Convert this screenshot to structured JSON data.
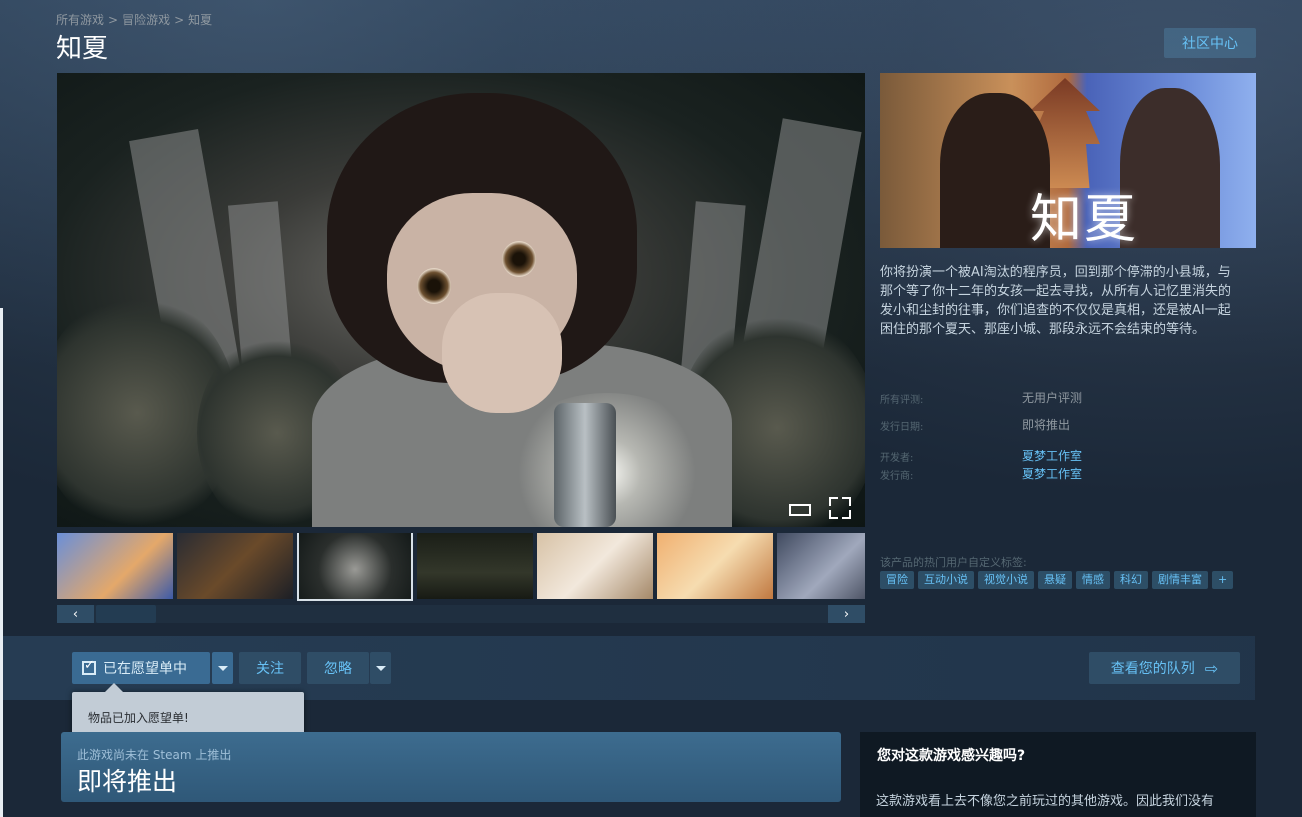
{
  "breadcrumb": {
    "root": "所有游戏",
    "category": "冒险游戏",
    "current": "知夏",
    "separator": ">"
  },
  "title": "知夏",
  "community_hub": "社区中心",
  "capsule_logo": "知夏",
  "description": "你将扮演一个被AI淘汰的程序员，回到那个停滞的小县城，与那个等了你十二年的女孩一起去寻找，从所有人记忆里消失的发小和尘封的往事，你们追查的不仅仅是真相，还是被AI一起困住的那个夏天、那座小城、那段永远不会结束的等待。",
  "meta": {
    "reviews_label": "所有评测:",
    "reviews_value": "无用户评测",
    "release_label": "发行日期:",
    "release_value": "即将推出",
    "developer_label": "开发者:",
    "developer_value": "夏梦工作室",
    "publisher_label": "发行商:",
    "publisher_value": "夏梦工作室"
  },
  "tags_label": "该产品的热门用户自定义标签:",
  "tags": [
    "冒险",
    "互动小说",
    "视觉小说",
    "悬疑",
    "情感",
    "科幻",
    "剧情丰富",
    "+"
  ],
  "media": {
    "selected_thumb_index": 2,
    "thumb_count": 7
  },
  "scroll": {
    "left": "‹",
    "right": "›"
  },
  "actions": {
    "wishlist": "已在愿望单中",
    "follow": "关注",
    "ignore": "忽略",
    "queue": "查看您的队列",
    "queue_arrow": "⇨"
  },
  "tooltip": "物品已加入愿望单!",
  "notice": {
    "small": "此游戏尚未在 Steam 上推出",
    "big": "即将推出"
  },
  "interest": {
    "title": "您对这款游戏感兴趣吗?",
    "text": "这款游戏看上去不像您之前玩过的其他游戏。因此我们没有"
  },
  "colors": {
    "accent": "#67c1f5",
    "link": "#66c0f4",
    "background": "#1b2838",
    "button": "#2f4d66",
    "wishlist_active": "#3a6b93"
  },
  "icons": {
    "fullscreen": "fullscreen-icon",
    "widescreen": "widescreen-icon",
    "checkbox": "checkbox-checked-icon",
    "queue": "arrow-right-icon"
  }
}
